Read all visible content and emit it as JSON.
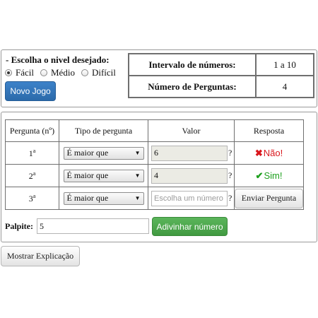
{
  "settings": {
    "label": "- Escolha o nivel desejado:",
    "levels": [
      {
        "label": "Fácil",
        "selected": true
      },
      {
        "label": "Médio",
        "selected": false
      },
      {
        "label": "Difícil",
        "selected": false
      }
    ],
    "new_game_label": "Novo Jogo"
  },
  "info": {
    "range_label": "Intervalo de números:",
    "range_value": "1 a 10",
    "count_label": "Número de Perguntas:",
    "count_value": "4"
  },
  "questions": {
    "headers": [
      "Pergunta (nº)",
      "Tipo de pergunta",
      "Valor",
      "Resposta"
    ],
    "rows": [
      {
        "num": "1",
        "ord": "a",
        "type": "É maior que",
        "value": "6",
        "qmark": "?",
        "answer_icon": "✖",
        "answer_text": "Não!"
      },
      {
        "num": "2",
        "ord": "a",
        "type": "É maior que",
        "value": "4",
        "qmark": "?",
        "answer_icon": "✔",
        "answer_text": "Sim!"
      },
      {
        "num": "3",
        "ord": "a",
        "type": "É maior que",
        "placeholder": "Escolha um número",
        "qmark": "?",
        "send_label": "Enviar Pergunta"
      }
    ]
  },
  "guess": {
    "label": "Palpite:",
    "value": "5",
    "button_label": "Adivinhar número"
  },
  "explain_label": "Mostrar Explicação",
  "colors": {
    "primary": "#2f72b8",
    "success": "#4cab4c",
    "answer_no": "#d9161c",
    "answer_yes": "#1ea01e",
    "disabled_input": "#ebebe4"
  }
}
